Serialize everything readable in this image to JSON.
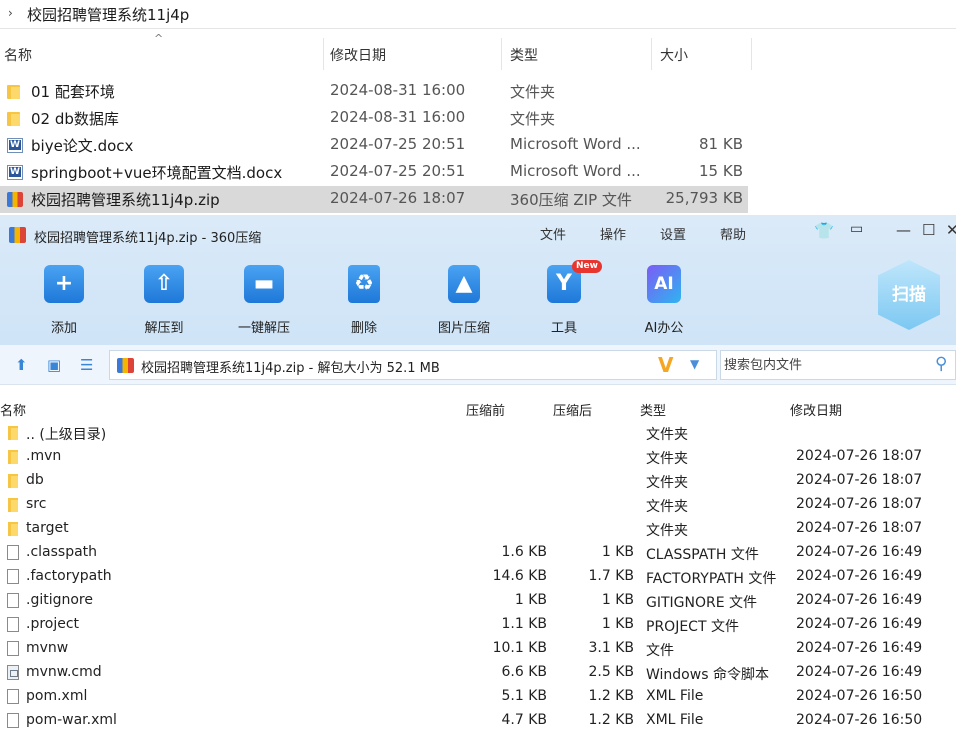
{
  "explorer": {
    "path": "校园招聘管理系统11j4p",
    "columns": {
      "name": "名称",
      "date": "修改日期",
      "type": "类型",
      "size": "大小"
    },
    "rows": [
      {
        "name": "01 配套环境",
        "date": "2024-08-31 16:00",
        "type": "文件夹",
        "size": "",
        "icon": "folder-icon"
      },
      {
        "name": "02 db数据库",
        "date": "2024-08-31 16:00",
        "type": "文件夹",
        "size": "",
        "icon": "folder-icon"
      },
      {
        "name": "biye论文.docx",
        "date": "2024-07-25 20:51",
        "type": "Microsoft Word ...",
        "size": "81 KB",
        "icon": "word-doc-icon"
      },
      {
        "name": "springboot+vue环境配置文档.docx",
        "date": "2024-07-25 20:51",
        "type": "Microsoft Word ...",
        "size": "15 KB",
        "icon": "word-doc-icon"
      },
      {
        "name": "校园招聘管理系统11j4p.zip",
        "date": "2024-07-26 18:07",
        "type": "360压缩 ZIP 文件",
        "size": "25,793 KB",
        "icon": "zip-archive-icon",
        "selected": true
      }
    ]
  },
  "zip_app": {
    "title": "校园招聘管理系统11j4p.zip - 360压缩",
    "menu": {
      "file": "文件",
      "operate": "操作",
      "settings": "设置",
      "help": "帮助"
    },
    "window_controls": {
      "minimize": "—",
      "maximize": "☐",
      "close": "✕"
    },
    "toolbar": {
      "add": "添加",
      "extract_to": "解压到",
      "one_click_extract": "一键解压",
      "delete": "删除",
      "image_compress": "图片压缩",
      "tools": "工具",
      "ai_office": "AI办公",
      "new_badge": "New",
      "scan": "扫描",
      "ai_icon_text": "AI"
    },
    "path_text": "校园招聘管理系统11j4p.zip - 解包大小为 52.1 MB",
    "search_placeholder": "搜索包内文件",
    "columns": {
      "name": "名称",
      "size": "压缩前",
      "compressed": "压缩后",
      "type": "类型",
      "date": "修改日期"
    },
    "files": [
      {
        "name": ".. (上级目录)",
        "size": "",
        "compressed": "",
        "type": "文件夹",
        "date": "",
        "icon": "folder-icon"
      },
      {
        "name": ".mvn",
        "size": "",
        "compressed": "",
        "type": "文件夹",
        "date": "2024-07-26 18:07",
        "icon": "folder-icon"
      },
      {
        "name": "db",
        "size": "",
        "compressed": "",
        "type": "文件夹",
        "date": "2024-07-26 18:07",
        "icon": "folder-icon"
      },
      {
        "name": "src",
        "size": "",
        "compressed": "",
        "type": "文件夹",
        "date": "2024-07-26 18:07",
        "icon": "folder-icon"
      },
      {
        "name": "target",
        "size": "",
        "compressed": "",
        "type": "文件夹",
        "date": "2024-07-26 18:07",
        "icon": "folder-icon"
      },
      {
        "name": ".classpath",
        "size": "1.6 KB",
        "compressed": "1 KB",
        "type": "CLASSPATH 文件",
        "date": "2024-07-26 16:49",
        "icon": "file-icon"
      },
      {
        "name": ".factorypath",
        "size": "14.6 KB",
        "compressed": "1.7 KB",
        "type": "FACTORYPATH 文件",
        "date": "2024-07-26 16:49",
        "icon": "file-icon"
      },
      {
        "name": ".gitignore",
        "size": "1 KB",
        "compressed": "1 KB",
        "type": "GITIGNORE 文件",
        "date": "2024-07-26 16:49",
        "icon": "file-icon"
      },
      {
        "name": ".project",
        "size": "1.1 KB",
        "compressed": "1 KB",
        "type": "PROJECT 文件",
        "date": "2024-07-26 16:49",
        "icon": "file-icon"
      },
      {
        "name": "mvnw",
        "size": "10.1 KB",
        "compressed": "3.1 KB",
        "type": "文件",
        "date": "2024-07-26 16:49",
        "icon": "file-icon"
      },
      {
        "name": "mvnw.cmd",
        "size": "6.6 KB",
        "compressed": "2.5 KB",
        "type": "Windows 命令脚本",
        "date": "2024-07-26 16:49",
        "icon": "cmd-script-icon"
      },
      {
        "name": "pom.xml",
        "size": "5.1 KB",
        "compressed": "1.2 KB",
        "type": "XML File",
        "date": "2024-07-26 16:50",
        "icon": "file-icon"
      },
      {
        "name": "pom-war.xml",
        "size": "4.7 KB",
        "compressed": "1.2 KB",
        "type": "XML File",
        "date": "2024-07-26 16:50",
        "icon": "file-icon"
      }
    ]
  }
}
